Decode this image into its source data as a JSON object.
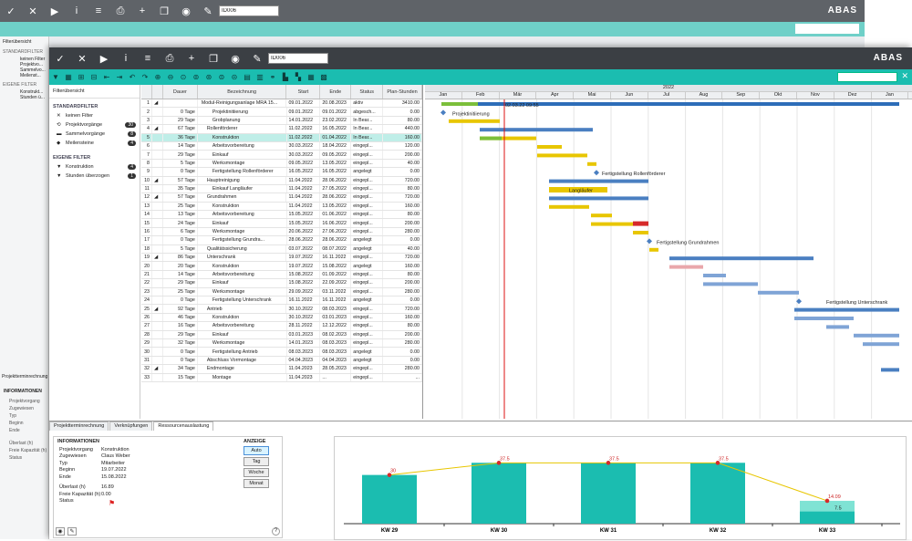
{
  "app": {
    "logo": "ABAS",
    "id_field": "ID006",
    "bg_id_field": "ID006"
  },
  "bg": {
    "filter_title": "Filterübersicht",
    "std": "STANDARDFILTER",
    "items": [
      "keinen Filter",
      "Projektvo...",
      "Sammelvo...",
      "Meilenst..."
    ],
    "own": "EIGENE FILTER",
    "own_items": [
      "Konstrukt...",
      "Stunden ü..."
    ],
    "info_tab": "Projektterminrechnung",
    "info_head": "INFORMATIONEN",
    "info_keys": [
      "Projektvorgang",
      "Zugewiesen",
      "Typ",
      "Beginn",
      "Ende",
      "Überlast (h)",
      "Freie Kapazität (h)",
      "Status"
    ]
  },
  "sidebar": {
    "title": "Filterübersicht",
    "std_header": "STANDARDFILTER",
    "std_items": [
      {
        "label": "keinen Filter",
        "count": ""
      },
      {
        "label": "Projektvorgänge",
        "count": "30"
      },
      {
        "label": "Sammelvorgänge",
        "count": "8"
      },
      {
        "label": "Meilensteine",
        "count": "4"
      }
    ],
    "own_header": "EIGENE FILTER",
    "own_items": [
      {
        "label": "Konstruktion",
        "count": "4"
      },
      {
        "label": "Stunden überzogen",
        "count": "1"
      }
    ]
  },
  "grid": {
    "headers": [
      "",
      "",
      "Dauer",
      "Bezeichnung",
      "Start",
      "Ende",
      "Status",
      "Plan-Stunden"
    ],
    "rows": [
      [
        "1",
        "◢",
        "",
        "Modul-Reinigungsanlage MRA 15...",
        "09.01.2022",
        "20.08.2023",
        "aktiv",
        "3410.00"
      ],
      [
        "2",
        "",
        "0 Tage",
        "Projektinitiierung",
        "09.01.2022",
        "09.01.2022",
        "abgesch...",
        "0.00"
      ],
      [
        "3",
        "",
        "29 Tage",
        "Grobplanung",
        "14.01.2022",
        "23.02.2022",
        "In Bear...",
        "80.00"
      ],
      [
        "4",
        "◢",
        "67 Tage",
        "Rollenförderer",
        "11.02.2022",
        "16.05.2022",
        "In Bear...",
        "440.00"
      ],
      [
        "5",
        "",
        "36 Tage",
        "Konstruktion",
        "11.02.2022",
        "01.04.2022",
        "In Bear...",
        "160.00"
      ],
      [
        "6",
        "",
        "14 Tage",
        "Arbeitsvorbereitung",
        "30.03.2022",
        "18.04.2022",
        "eingepl...",
        "120.00"
      ],
      [
        "7",
        "",
        "29 Tage",
        "Einkauf",
        "30.03.2022",
        "09.05.2022",
        "eingepl...",
        "200.00"
      ],
      [
        "8",
        "",
        "5 Tage",
        "Werksmontage",
        "09.05.2022",
        "13.05.2022",
        "eingepl...",
        "40.00"
      ],
      [
        "9",
        "",
        "0 Tage",
        "Fertigstellung Rollenförderer",
        "16.05.2022",
        "16.05.2022",
        "angelegt",
        "0.00"
      ],
      [
        "10",
        "◢",
        "57 Tage",
        "Hauptreinigung",
        "11.04.2022",
        "28.06.2022",
        "eingepl...",
        "720.00"
      ],
      [
        "11",
        "",
        "35 Tage",
        "Einkauf Langläufer",
        "11.04.2022",
        "27.05.2022",
        "eingepl...",
        "80.00"
      ],
      [
        "12",
        "◢",
        "57 Tage",
        "Grundrahmen",
        "11.04.2022",
        "28.06.2022",
        "eingepl...",
        "720.00"
      ],
      [
        "13",
        "",
        "25 Tage",
        "Konstruktion",
        "11.04.2022",
        "13.05.2022",
        "eingepl...",
        "160.00"
      ],
      [
        "14",
        "",
        "13 Tage",
        "Arbeitsvorbereitung",
        "15.05.2022",
        "01.06.2022",
        "eingepl...",
        "80.00"
      ],
      [
        "15",
        "",
        "24 Tage",
        "Einkauf",
        "15.05.2022",
        "16.06.2022",
        "eingepl...",
        "200.00"
      ],
      [
        "16",
        "",
        "6 Tage",
        "Werksmontage",
        "20.06.2022",
        "27.06.2022",
        "eingepl...",
        "280.00"
      ],
      [
        "17",
        "",
        "0 Tage",
        "Fertigstellung Grundra...",
        "28.06.2022",
        "28.06.2022",
        "angelegt",
        "0.00"
      ],
      [
        "18",
        "",
        "5 Tage",
        "Qualitätssicherung",
        "03.07.2022",
        "08.07.2022",
        "angelegt",
        "40.00"
      ],
      [
        "19",
        "◢",
        "86 Tage",
        "Unterschrank",
        "19.07.2022",
        "16.11.2022",
        "eingepl...",
        "720.00"
      ],
      [
        "20",
        "",
        "20 Tage",
        "Konstruktion",
        "19.07.2022",
        "15.08.2022",
        "angelegt",
        "160.00"
      ],
      [
        "21",
        "",
        "14 Tage",
        "Arbeitsvorbereitung",
        "15.08.2022",
        "01.09.2022",
        "eingepl...",
        "80.00"
      ],
      [
        "22",
        "",
        "29 Tage",
        "Einkauf",
        "15.08.2022",
        "22.09.2022",
        "eingepl...",
        "200.00"
      ],
      [
        "23",
        "",
        "25 Tage",
        "Werksmontage",
        "29.09.2022",
        "03.11.2022",
        "eingepl...",
        "280.00"
      ],
      [
        "24",
        "",
        "0 Tage",
        "Fertigstellung Unterschrank",
        "16.11.2022",
        "16.11.2022",
        "angelegt",
        "0.00"
      ],
      [
        "25",
        "◢",
        "92 Tage",
        "Antrieb",
        "30.10.2022",
        "08.03.2023",
        "eingepl...",
        "720.00"
      ],
      [
        "26",
        "",
        "46 Tage",
        "Konstruktion",
        "30.10.2022",
        "03.01.2023",
        "eingepl...",
        "160.00"
      ],
      [
        "27",
        "",
        "16 Tage",
        "Arbeitsvorbereitung",
        "28.11.2022",
        "12.12.2022",
        "eingepl...",
        "80.00"
      ],
      [
        "28",
        "",
        "29 Tage",
        "Einkauf",
        "03.01.2023",
        "08.02.2023",
        "eingepl...",
        "200.00"
      ],
      [
        "29",
        "",
        "32 Tage",
        "Werksmontage",
        "14.01.2023",
        "08.03.2023",
        "eingepl...",
        "280.00"
      ],
      [
        "30",
        "",
        "0 Tage",
        "Fertigstellung Antrieb",
        "08.03.2023",
        "08.03.2023",
        "angelegt",
        "0.00"
      ],
      [
        "31",
        "",
        "0 Tage",
        "Abschluss Vormontage",
        "04.04.2023",
        "04.04.2023",
        "angelegt",
        "0.00"
      ],
      [
        "32",
        "◢",
        "34 Tage",
        "Endmontage",
        "11.04.2023",
        "28.05.2023",
        "eingepl...",
        "280.00"
      ],
      [
        "33",
        "",
        "15 Tage",
        "Montage",
        "11.04.2023",
        "...",
        "eingepl...",
        "..."
      ]
    ]
  },
  "gantt": {
    "year": "2022",
    "months": [
      "Jan",
      "Feb",
      "Mär",
      "Apr",
      "Mai",
      "Jun",
      "Jul",
      "Aug",
      "Sep",
      "Okt",
      "Nov",
      "Dez",
      "Jan"
    ],
    "today": "02.03.22 09:55",
    "labels": [
      "Projektinitiierung",
      "Fertigstellung Rollenförderer",
      "Langläufer",
      "Fertigstellung Grundrahmen",
      "Fertigstellung Unterschrank"
    ]
  },
  "bottom": {
    "tabs": [
      "Projektterminrechnung",
      "Verknüpfungen",
      "Ressourcenauslastung"
    ],
    "info_header": "INFORMATIONEN",
    "info": [
      [
        "Projektvorgang",
        "Konstruktion"
      ],
      [
        "Zugewiesen",
        "Claus Weber"
      ],
      [
        "Typ",
        "Mitarbeiter"
      ],
      [
        "Beginn",
        "19.07.2022"
      ],
      [
        "Ende",
        "15.08.2022"
      ]
    ],
    "info2": [
      [
        "Überlast (h)",
        "16.89"
      ],
      [
        "Freie Kapazität (h)",
        "0.00"
      ],
      [
        "Status",
        ""
      ]
    ],
    "view_header": "ANZEIGE",
    "views": [
      "Auto",
      "Tag",
      "Woche",
      "Monat"
    ]
  },
  "chart_data": {
    "type": "bar",
    "categories": [
      "KW 29",
      "KW 30",
      "KW 31",
      "KW 32",
      "KW 33"
    ],
    "series": [
      {
        "values": [
          30,
          37.5,
          37.5,
          37.5,
          7.5
        ]
      },
      {
        "values": [
          30,
          37.5,
          37.5,
          37.5,
          14.09
        ]
      }
    ],
    "labels": [
      "30",
      "37.5",
      "37.5",
      "37.5",
      "14.09",
      "7.5"
    ],
    "ylim": [
      0,
      45
    ]
  }
}
